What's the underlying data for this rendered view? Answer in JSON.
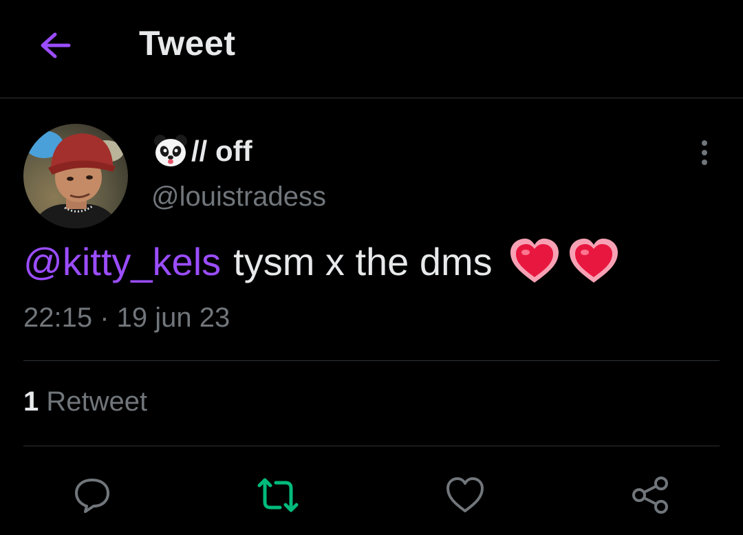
{
  "header": {
    "title": "Tweet",
    "back_icon": "arrow-left-icon",
    "accent": "#9b4dff"
  },
  "author": {
    "display_name_emoji": "panda-face",
    "display_name": "// off",
    "handle": "@louistradess",
    "avatar": "avatar"
  },
  "tweet": {
    "mention": "@kitty_kels",
    "text": "tysm x the dms",
    "emojis": [
      "heart-emoji",
      "heart-emoji"
    ],
    "timestamp": "22:15 · 19 jun 23"
  },
  "stats": {
    "retweet_count": "1",
    "retweet_label": "Retweet"
  },
  "actions": [
    {
      "name": "reply",
      "icon": "reply-icon",
      "color": "#71767b"
    },
    {
      "name": "retweet",
      "icon": "retweet-icon",
      "color": "#00ba7c"
    },
    {
      "name": "like",
      "icon": "heart-icon",
      "color": "#71767b"
    },
    {
      "name": "share",
      "icon": "share-icon",
      "color": "#71767b"
    }
  ],
  "colors": {
    "background": "#000000",
    "text": "#e7e9ea",
    "secondary": "#71767b",
    "mention": "#9b4dff",
    "retweeted": "#00ba7c",
    "divider": "#2f3336"
  }
}
